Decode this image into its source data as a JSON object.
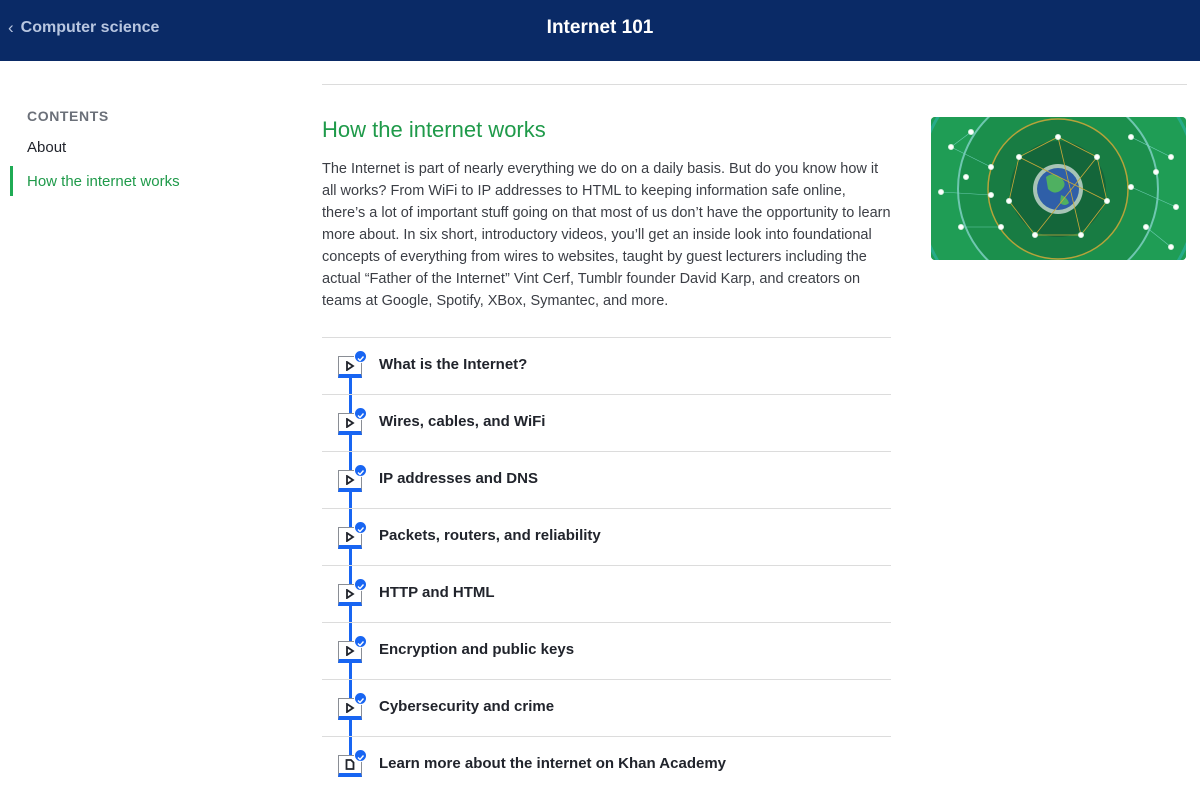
{
  "header": {
    "back_label": "Computer science",
    "back_icon": "chevron-left-icon",
    "title": "Internet 101"
  },
  "sidebar": {
    "heading": "CONTENTS",
    "items": [
      {
        "label": "About",
        "active": false
      },
      {
        "label": "How the internet works",
        "active": true
      }
    ]
  },
  "main": {
    "section_title": "How the internet works",
    "description": "The Internet is part of nearly everything we do on a daily basis. But do you know how it all works? From WiFi to IP addresses to HTML to keeping information safe online, there’s a lot of important stuff going on that most of us don’t have the opportunity to learn more about. In six short, introductory videos, you’ll get an inside look into foundational concepts of everything from wires to websites, taught by guest lecturers including the actual “Father of the Internet” Vint Cerf, Tumblr founder David Karp, and creators on teams at Google, Spotify, XBox, Symantec, and more.",
    "hero_image": "globe-network-illustration",
    "accent_color": "#1865f2",
    "lessons": [
      {
        "label": "What is the Internet?",
        "type": "video",
        "completed": true
      },
      {
        "label": "Wires, cables, and WiFi",
        "type": "video",
        "completed": true
      },
      {
        "label": "IP addresses and DNS",
        "type": "video",
        "completed": true
      },
      {
        "label": "Packets, routers, and reliability",
        "type": "video",
        "completed": true
      },
      {
        "label": "HTTP and HTML",
        "type": "video",
        "completed": true
      },
      {
        "label": "Encryption and public keys",
        "type": "video",
        "completed": true
      },
      {
        "label": "Cybersecurity and crime",
        "type": "video",
        "completed": true
      },
      {
        "label": "Learn more about the internet on Khan Academy",
        "type": "article",
        "completed": true
      }
    ]
  }
}
